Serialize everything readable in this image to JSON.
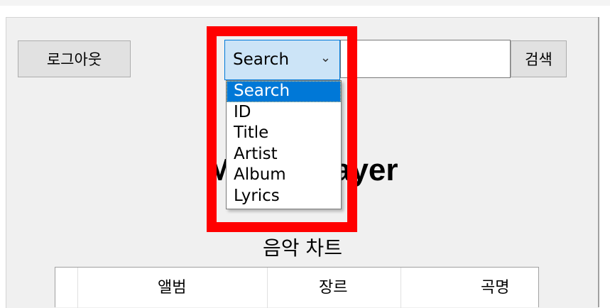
{
  "toolbar": {
    "logout_label": "로그아웃",
    "search_button_label": "검색",
    "search_text_value": ""
  },
  "search_combo": {
    "selected": "Search",
    "options": [
      "Search",
      "ID",
      "Title",
      "Artist",
      "Album",
      "Lyrics"
    ]
  },
  "main": {
    "title": "Music Player",
    "chart_label": "음악 차트"
  },
  "table": {
    "columns": [
      "",
      "앨범",
      "장르",
      "곡명"
    ]
  },
  "colors": {
    "highlight": "#0078d7",
    "combo_bg": "#cce4f7",
    "annotation": "#ff0000"
  }
}
